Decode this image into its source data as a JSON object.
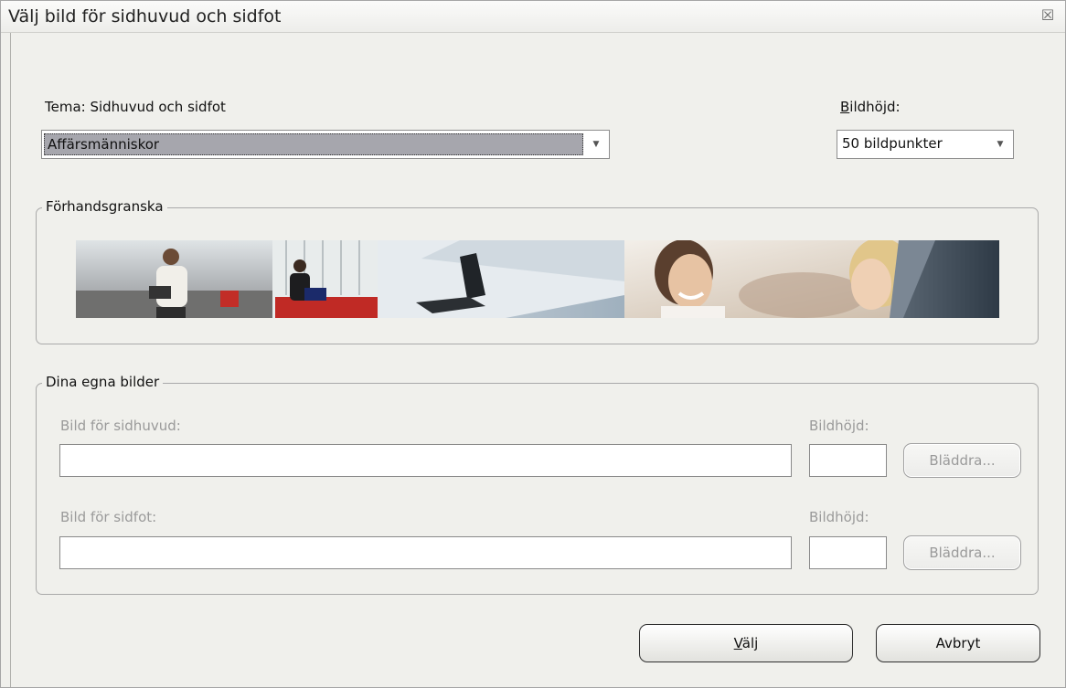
{
  "dialog": {
    "title": "Välj bild för sidhuvud och sidfot",
    "close_glyph": "☒"
  },
  "theme": {
    "label_prefix": "Tema: Sidhuvud och sidfot",
    "selected": "Affärsmänniskor"
  },
  "height": {
    "label_accel": "B",
    "label_rest": "ildhöjd:",
    "selected": "50 bildpunkter"
  },
  "preview": {
    "legend": "Förhandsgranska"
  },
  "own_images": {
    "legend": "Dina egna bilder",
    "header_label": "Bild för sidhuvud:",
    "header_height_label": "Bildhöjd:",
    "header_value": "",
    "header_height_value": "",
    "footer_label": "Bild för sidfot:",
    "footer_height_label": "Bildhöjd:",
    "footer_value": "",
    "footer_height_value": "",
    "browse_label": "Bläddra..."
  },
  "buttons": {
    "ok_accel": "V",
    "ok_rest": "älj",
    "cancel": "Avbryt"
  },
  "icons": {
    "dropdown": "chevron-down-icon",
    "close": "close-icon"
  }
}
